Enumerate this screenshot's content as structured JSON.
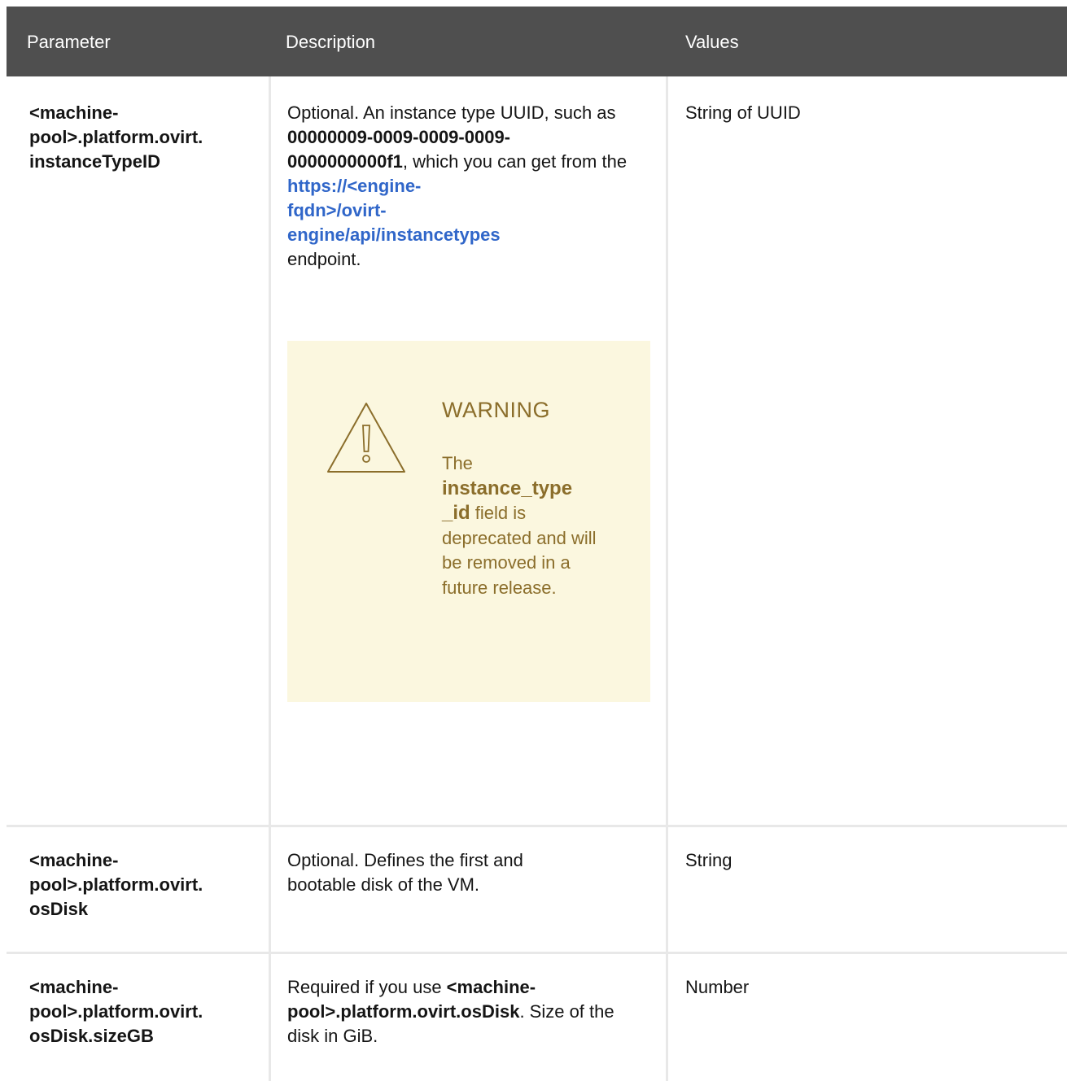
{
  "header": {
    "col_parameter": "Parameter",
    "col_description": "Description",
    "col_values": "Values"
  },
  "rows": [
    {
      "param_lines": [
        "<machine-",
        "pool>.platform.ovirt.",
        "instanceTypeID"
      ],
      "desc_intro": "Optional. An instance type UUID, such as ",
      "desc_uuid_1": "00000009-0009-0009-0009-",
      "desc_uuid_2": "0000000000f1",
      "desc_mid": ", which you can get from the ",
      "desc_link_1": "https://<engine-",
      "desc_link_2": "fqdn>/ovirt-",
      "desc_link_3": "engine/api/instancetypes",
      "desc_end": "endpoint.",
      "warning": {
        "icon": "warning-triangle-icon",
        "title": "WARNING",
        "text_before": "The",
        "field_1": "instance_type",
        "field_2": "_id",
        "text_after": " field is deprecated and will be removed in a future release.",
        "color": "#8b6e2b",
        "background": "#fbf7df"
      },
      "value": "String of UUID"
    },
    {
      "param_lines": [
        "<machine-",
        "pool>.platform.ovirt.",
        "osDisk"
      ],
      "description": "Optional. Defines the first and bootable disk of the VM.",
      "value": "String"
    },
    {
      "param_lines": [
        "<machine-",
        "pool>.platform.ovirt.",
        "osDisk.sizeGB"
      ],
      "desc_before": "Required if you use ",
      "desc_bold": "<machine-pool>.platform.ovirt.osDisk",
      "desc_after": ". Size of the disk in GiB.",
      "value": "Number"
    }
  ],
  "colors": {
    "header_bg": "#4f4f4f",
    "link": "#3066c9",
    "border": "#e8e8e8"
  }
}
